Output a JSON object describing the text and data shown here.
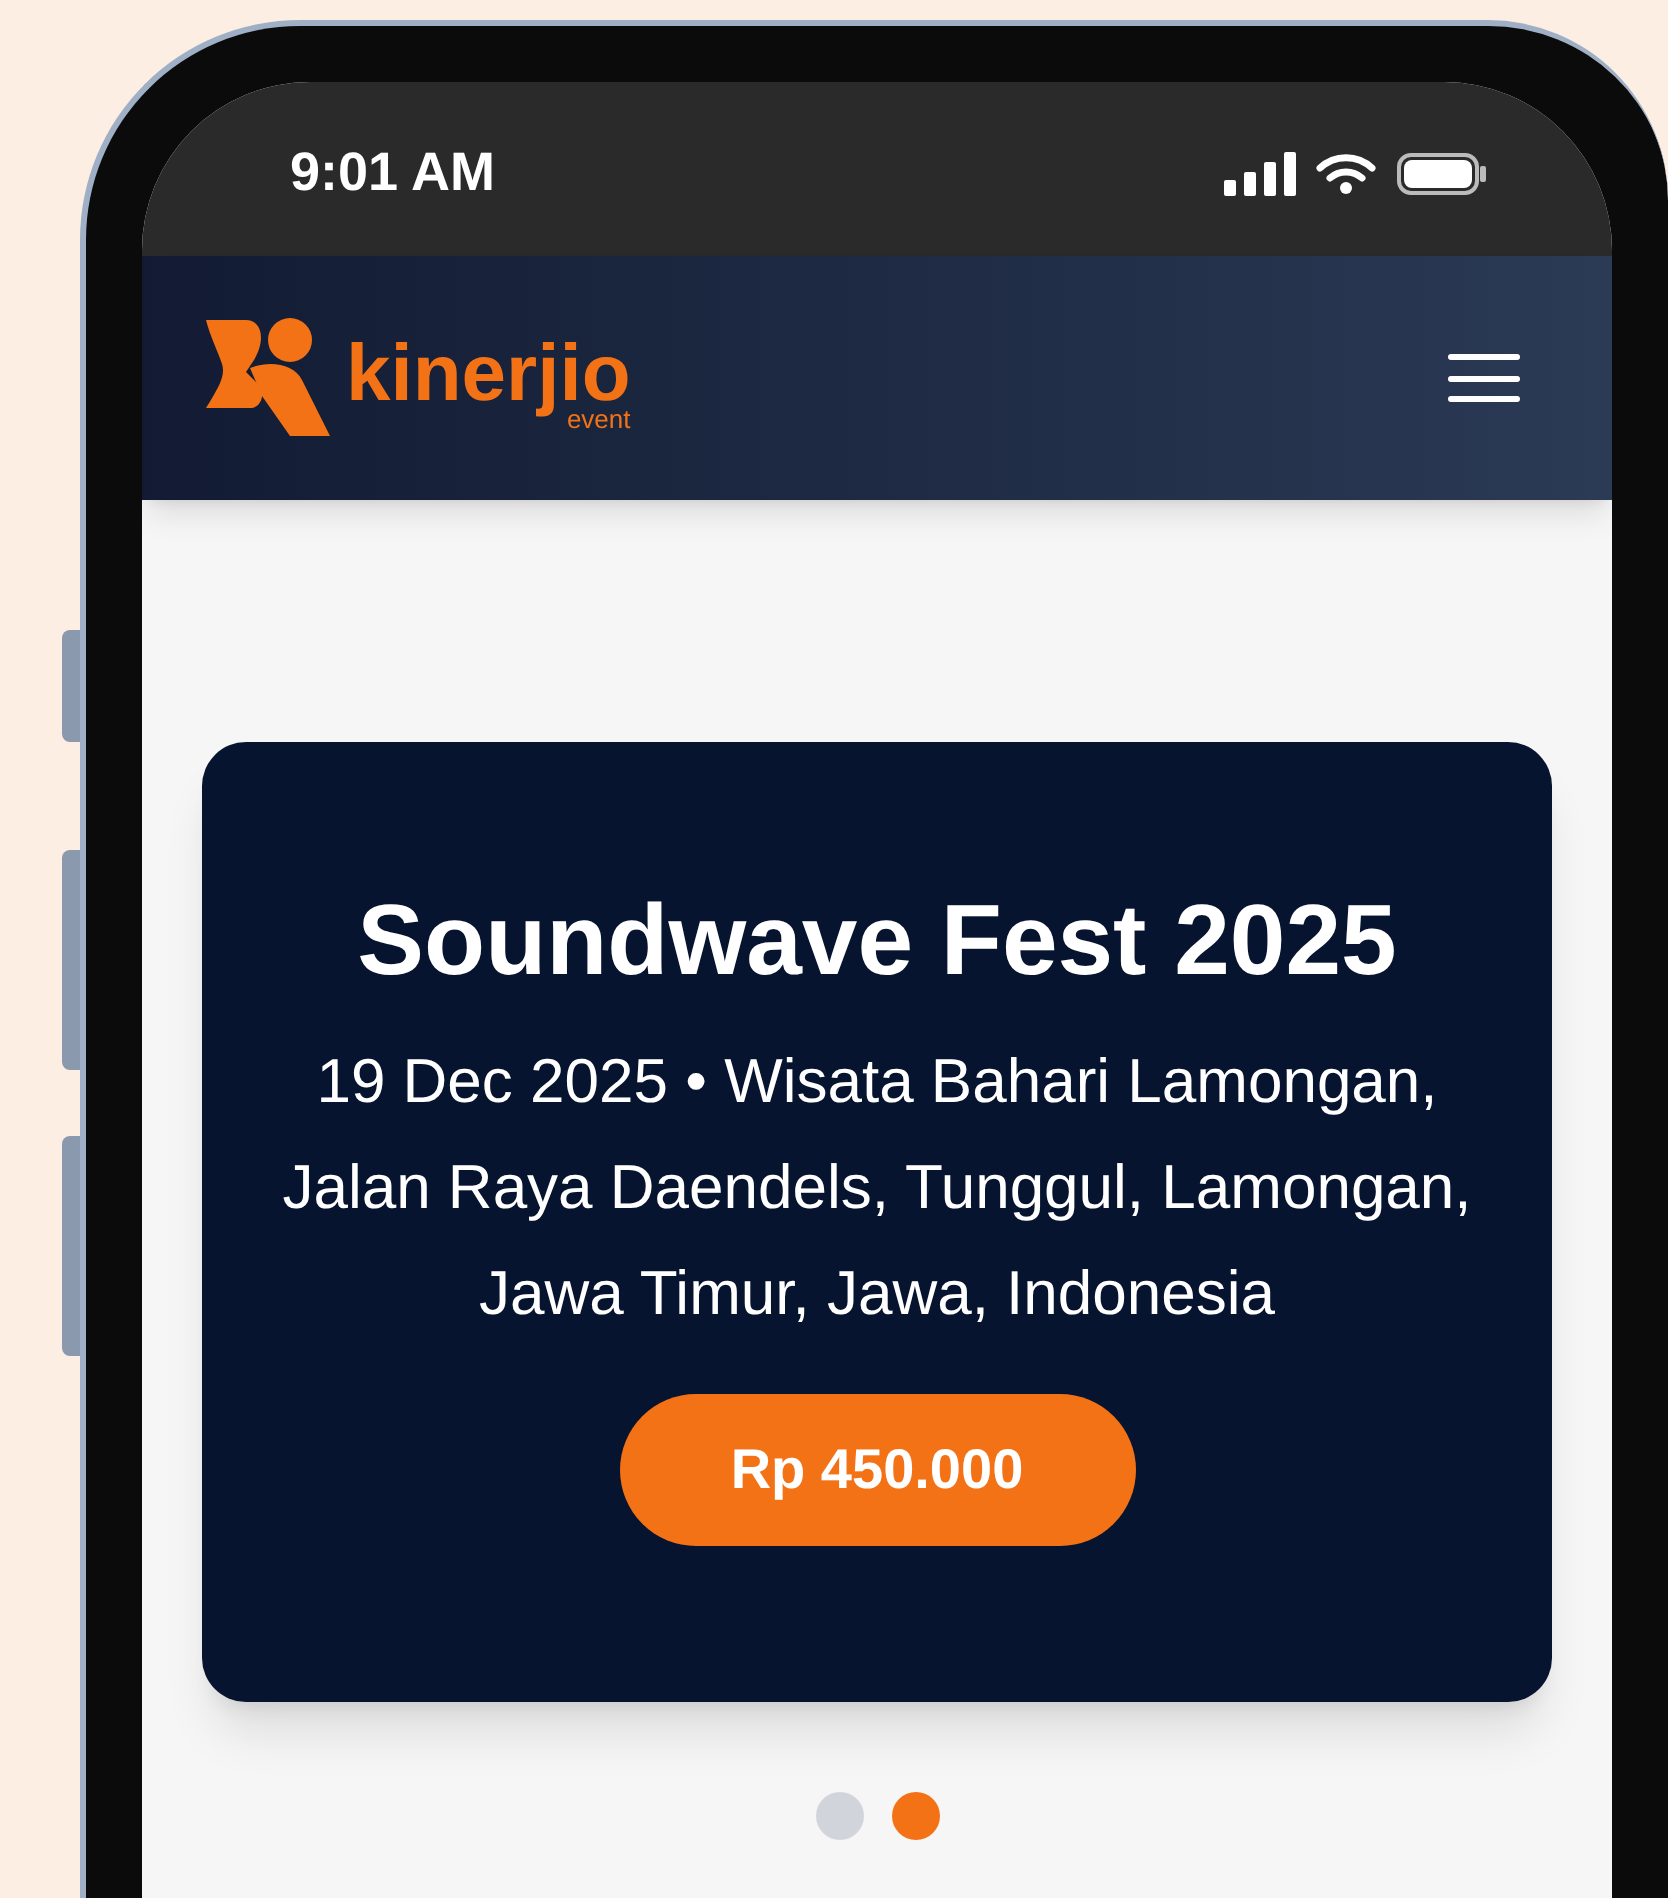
{
  "status_bar": {
    "time": "9:01 AM"
  },
  "header": {
    "logo": {
      "name": "kinerjio",
      "tagline": "event"
    }
  },
  "banner": {
    "title": "Soundwave Fest 2025",
    "details": "19 Dec 2025 • Wisata Bahari Lamongan, Jalan Raya Daendels, Tunggul, Lamongan, Jawa Timur, Jawa, Indonesia",
    "price": "Rp 450.000"
  },
  "carousel_dots": [
    {
      "selected": false
    },
    {
      "selected": true
    }
  ]
}
